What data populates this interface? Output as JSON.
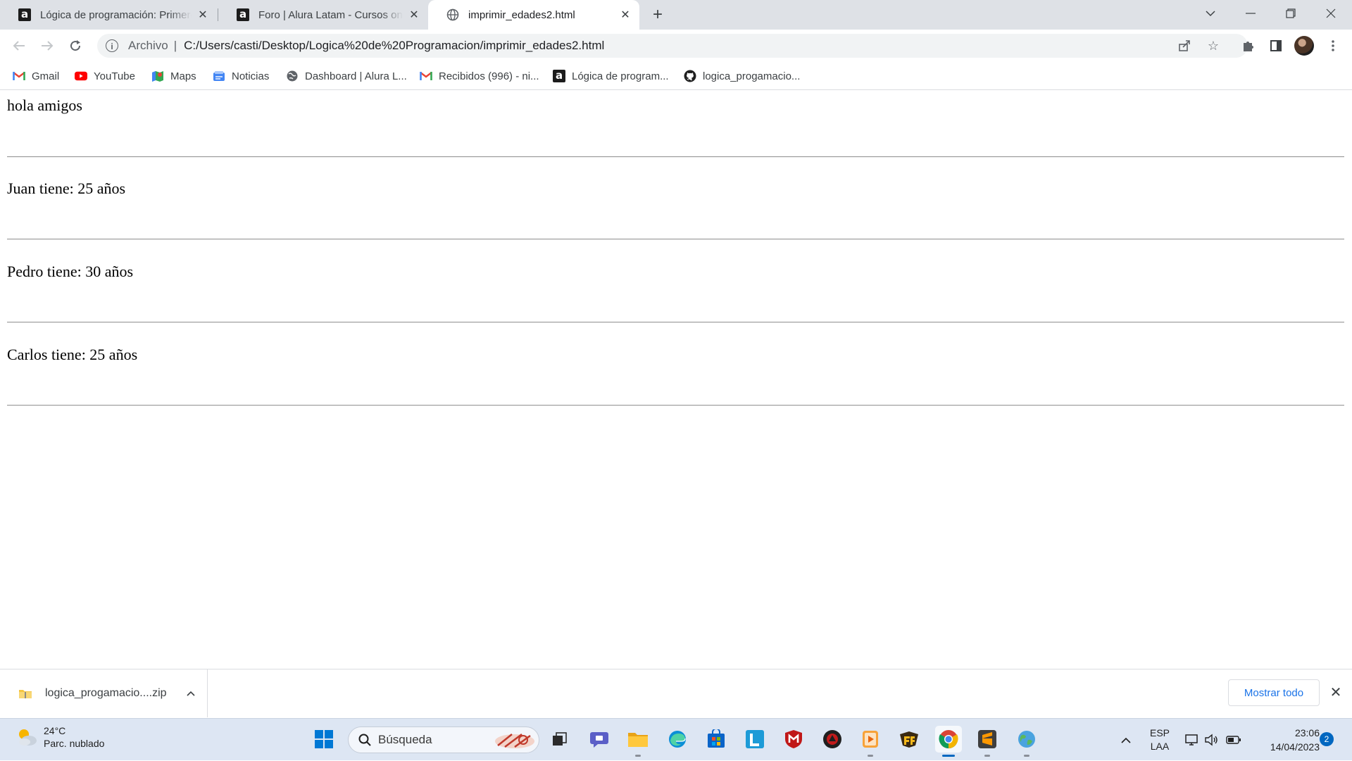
{
  "tabs": [
    {
      "title": "Lógica de programación: Primeros pasos",
      "favicon": "alura-icon",
      "active": false
    },
    {
      "title": "Foro | Alura Latam - Cursos online de tecnología",
      "favicon": "alura-icon",
      "active": false
    },
    {
      "title": "imprimir_edades2.html",
      "favicon": "globe-icon",
      "active": true
    }
  ],
  "toolbar": {
    "scheme_label": "Archivo",
    "separator": "|",
    "url": "C:/Users/casti/Desktop/Logica%20de%20Programacion/imprimir_edades2.html"
  },
  "bookmarks": [
    {
      "label": "Gmail",
      "icon": "gmail-icon"
    },
    {
      "label": "YouTube",
      "icon": "youtube-icon"
    },
    {
      "label": "Maps",
      "icon": "maps-icon"
    },
    {
      "label": "Noticias",
      "icon": "news-icon"
    },
    {
      "label": "Dashboard | Alura L...",
      "icon": "globe-icon"
    },
    {
      "label": "Recibidos (996) - ni...",
      "icon": "gmail-icon"
    },
    {
      "label": "Lógica de program...",
      "icon": "alura-icon"
    },
    {
      "label": "logica_progamacio...",
      "icon": "github-icon"
    }
  ],
  "page": {
    "lines": [
      "hola amigos",
      "Juan tiene: 25 años",
      "Pedro tiene: 30 años",
      "Carlos tiene: 25 años"
    ]
  },
  "download": {
    "filename": "logica_progamacio....zip",
    "show_all": "Mostrar todo"
  },
  "taskbar": {
    "temperature": "24°C",
    "weather_desc": "Parc. nublado",
    "search_placeholder": "Búsqueda",
    "lang_1": "ESP",
    "lang_2": "LAA",
    "time": "23:06",
    "date": "14/04/2023",
    "notifications": "2"
  },
  "colors": {
    "tabstrip_bg": "#dee1e6",
    "taskbar_bg": "#dde6f3",
    "link_blue": "#1a73e8",
    "windows_accent": "#0067c0"
  }
}
